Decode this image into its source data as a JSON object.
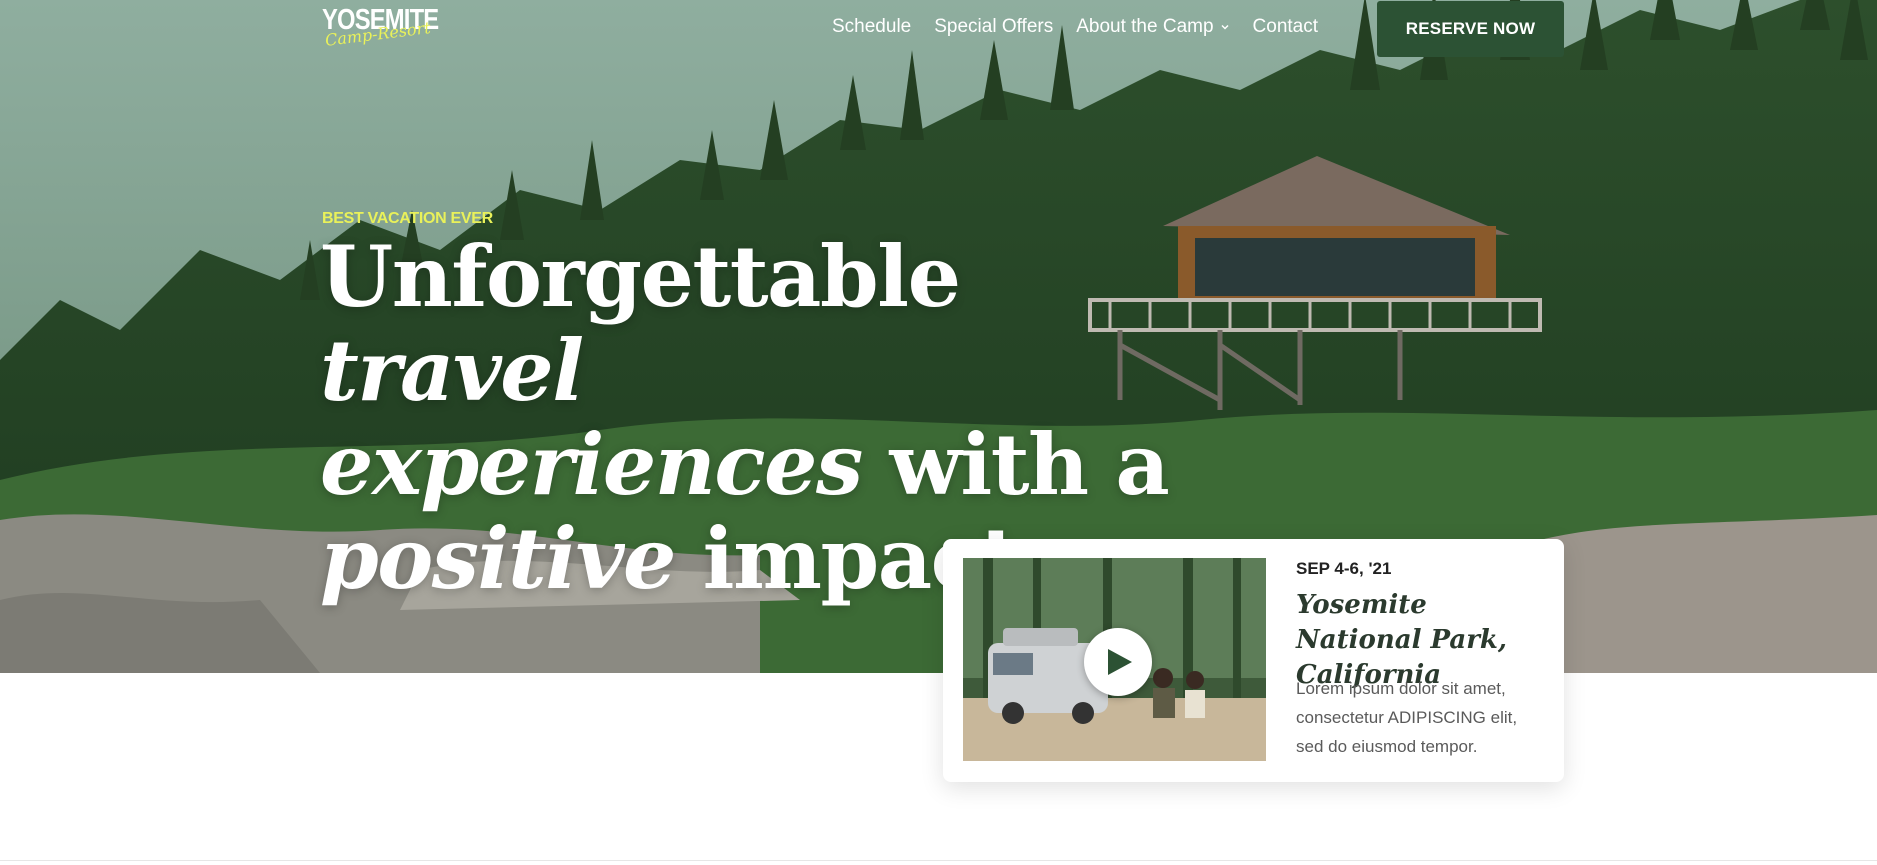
{
  "logo": {
    "main": "YOSEMITE",
    "sub": "Camp-Resort"
  },
  "nav": {
    "items": [
      {
        "label": "Schedule"
      },
      {
        "label": "Special Offers"
      },
      {
        "label": "About the Camp"
      },
      {
        "label": "Contact"
      }
    ],
    "cta": "RESERVE NOW"
  },
  "hero": {
    "eyebrow": "BEST VACATION EVER",
    "headline": {
      "line1_regular": "Unforgettable ",
      "line1_italic": "travel",
      "line2_italic": "experiences",
      "line2_regular": " with a",
      "line3_italic": "positive",
      "line3_regular": " impact."
    }
  },
  "event_card": {
    "date": "SEP 4-6, '21",
    "title": "Yosemite National Park, California",
    "description": "Lorem ipsum dolor sit amet, consectetur ADIPISCING elit, sed do eiusmod tempor.",
    "thumbnail_icon": "play-icon"
  },
  "colors": {
    "brand_green": "#2c5234",
    "accent_yellow": "#e9f15a",
    "text_dark": "#2b3a2e"
  }
}
